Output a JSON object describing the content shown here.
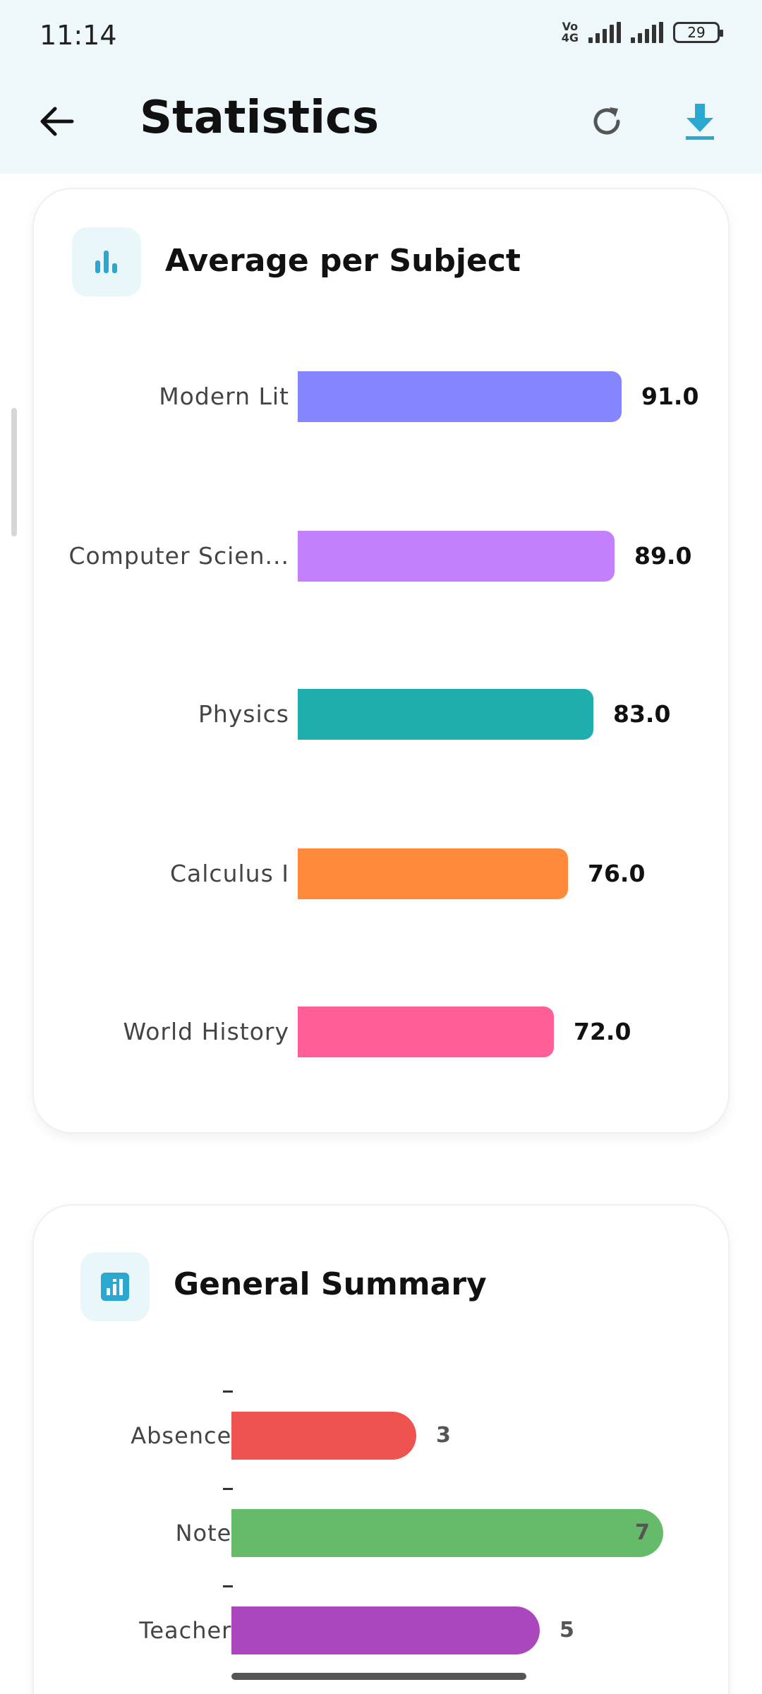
{
  "status": {
    "time": "11:14",
    "network_top": "Vo",
    "network_bottom": "4G",
    "battery": "29"
  },
  "header": {
    "title": "Statistics"
  },
  "colors": {
    "accent": "#2aa8d0",
    "header_bg": "#eef7fa"
  },
  "average_card": {
    "title": "Average per Subject",
    "icon": "bar-chart-icon",
    "chart_data": {
      "type": "bar",
      "orientation": "horizontal",
      "categories": [
        "Modern Lit",
        "Computer Scien...",
        "Physics",
        "Calculus I",
        "World History"
      ],
      "values": [
        91.0,
        89.0,
        83.0,
        76.0,
        72.0
      ],
      "labels": [
        "91.0",
        "89.0",
        "83.0",
        "76.0",
        "72.0"
      ],
      "colors": [
        "#8585fd",
        "#c47ffc",
        "#1eaeae",
        "#ff8a3c",
        "#ff5e98"
      ]
    }
  },
  "summary_card": {
    "title": "General Summary",
    "icon": "analytics-icon",
    "chart_data": {
      "type": "bar",
      "orientation": "horizontal",
      "categories": [
        "Absences",
        "Notes",
        "Teachers"
      ],
      "values": [
        3,
        7,
        5
      ],
      "labels": [
        "3",
        "7",
        "5"
      ],
      "colors": [
        "#ef5350",
        "#66bb6a",
        "#ab47bc"
      ]
    }
  }
}
